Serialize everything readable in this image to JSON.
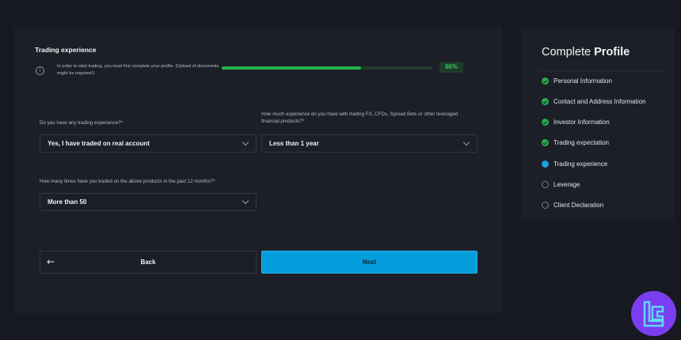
{
  "form": {
    "section_title": "Trading experience",
    "info_text": "In order to start trading, you must first complete your profile. (Upload of documents might be required!)",
    "progress": {
      "value": 0.66,
      "label": "66%"
    },
    "questions": [
      {
        "label": "Do you have any trading experience?*",
        "value": "Yes, I have traded on real account"
      },
      {
        "label": "How much experience do you have with trading FX, CFDs, Spread Bets or other leveraged financial products?*",
        "value": "Less than 1 year"
      },
      {
        "label": "How many times have you traded on the above products in the past 12 months?*",
        "value": "More than 50"
      }
    ],
    "back_label": "Back",
    "next_label": "Next"
  },
  "sidebar": {
    "title_prefix": "Complete",
    "title_bold": "Profile",
    "steps": [
      {
        "label": "Personal Information",
        "status": "done"
      },
      {
        "label": "Contact and Address Information",
        "status": "done"
      },
      {
        "label": "Investor Information",
        "status": "done"
      },
      {
        "label": "Trading expectation",
        "status": "done"
      },
      {
        "label": "Trading experience",
        "status": "active"
      },
      {
        "label": "Leverage",
        "status": "pending"
      },
      {
        "label": "Client Declaration",
        "status": "pending"
      }
    ]
  },
  "icons": {
    "info": "info-icon",
    "chevron": "chevron-down-icon",
    "back": "arrow-left-icon",
    "step_done": "check-circle-icon",
    "step_active": "current-step-dot-icon",
    "step_pending": "empty-circle-icon",
    "logo": "brand-logo-icon"
  },
  "colors": {
    "accent": "#049ddc",
    "success": "#27ae4f",
    "background": "#16191f",
    "panel": "#1c1f27",
    "logo": "#7a3ef0"
  }
}
